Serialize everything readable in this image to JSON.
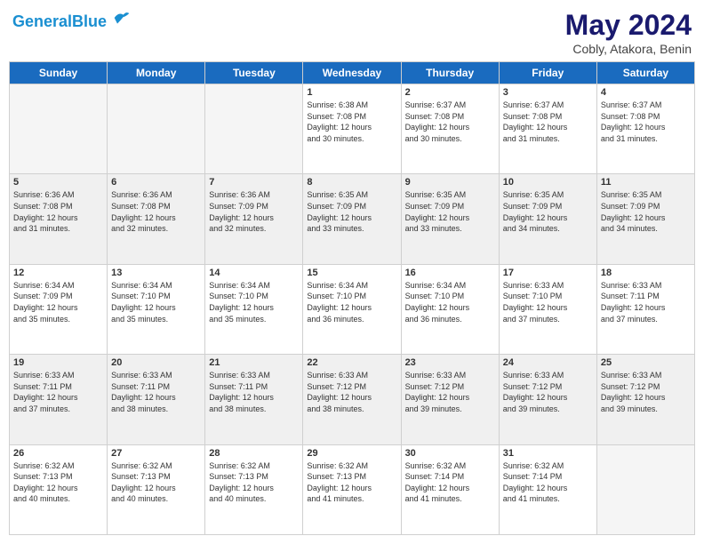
{
  "header": {
    "logo_line1": "General",
    "logo_line2": "Blue",
    "title": "May 2024",
    "subtitle": "Cobly, Atakora, Benin"
  },
  "weekdays": [
    "Sunday",
    "Monday",
    "Tuesday",
    "Wednesday",
    "Thursday",
    "Friday",
    "Saturday"
  ],
  "weeks": [
    {
      "shaded": false,
      "days": [
        {
          "num": "",
          "info": ""
        },
        {
          "num": "",
          "info": ""
        },
        {
          "num": "",
          "info": ""
        },
        {
          "num": "1",
          "info": "Sunrise: 6:38 AM\nSunset: 7:08 PM\nDaylight: 12 hours\nand 30 minutes."
        },
        {
          "num": "2",
          "info": "Sunrise: 6:37 AM\nSunset: 7:08 PM\nDaylight: 12 hours\nand 30 minutes."
        },
        {
          "num": "3",
          "info": "Sunrise: 6:37 AM\nSunset: 7:08 PM\nDaylight: 12 hours\nand 31 minutes."
        },
        {
          "num": "4",
          "info": "Sunrise: 6:37 AM\nSunset: 7:08 PM\nDaylight: 12 hours\nand 31 minutes."
        }
      ]
    },
    {
      "shaded": true,
      "days": [
        {
          "num": "5",
          "info": "Sunrise: 6:36 AM\nSunset: 7:08 PM\nDaylight: 12 hours\nand 31 minutes."
        },
        {
          "num": "6",
          "info": "Sunrise: 6:36 AM\nSunset: 7:08 PM\nDaylight: 12 hours\nand 32 minutes."
        },
        {
          "num": "7",
          "info": "Sunrise: 6:36 AM\nSunset: 7:09 PM\nDaylight: 12 hours\nand 32 minutes."
        },
        {
          "num": "8",
          "info": "Sunrise: 6:35 AM\nSunset: 7:09 PM\nDaylight: 12 hours\nand 33 minutes."
        },
        {
          "num": "9",
          "info": "Sunrise: 6:35 AM\nSunset: 7:09 PM\nDaylight: 12 hours\nand 33 minutes."
        },
        {
          "num": "10",
          "info": "Sunrise: 6:35 AM\nSunset: 7:09 PM\nDaylight: 12 hours\nand 34 minutes."
        },
        {
          "num": "11",
          "info": "Sunrise: 6:35 AM\nSunset: 7:09 PM\nDaylight: 12 hours\nand 34 minutes."
        }
      ]
    },
    {
      "shaded": false,
      "days": [
        {
          "num": "12",
          "info": "Sunrise: 6:34 AM\nSunset: 7:09 PM\nDaylight: 12 hours\nand 35 minutes."
        },
        {
          "num": "13",
          "info": "Sunrise: 6:34 AM\nSunset: 7:10 PM\nDaylight: 12 hours\nand 35 minutes."
        },
        {
          "num": "14",
          "info": "Sunrise: 6:34 AM\nSunset: 7:10 PM\nDaylight: 12 hours\nand 35 minutes."
        },
        {
          "num": "15",
          "info": "Sunrise: 6:34 AM\nSunset: 7:10 PM\nDaylight: 12 hours\nand 36 minutes."
        },
        {
          "num": "16",
          "info": "Sunrise: 6:34 AM\nSunset: 7:10 PM\nDaylight: 12 hours\nand 36 minutes."
        },
        {
          "num": "17",
          "info": "Sunrise: 6:33 AM\nSunset: 7:10 PM\nDaylight: 12 hours\nand 37 minutes."
        },
        {
          "num": "18",
          "info": "Sunrise: 6:33 AM\nSunset: 7:11 PM\nDaylight: 12 hours\nand 37 minutes."
        }
      ]
    },
    {
      "shaded": true,
      "days": [
        {
          "num": "19",
          "info": "Sunrise: 6:33 AM\nSunset: 7:11 PM\nDaylight: 12 hours\nand 37 minutes."
        },
        {
          "num": "20",
          "info": "Sunrise: 6:33 AM\nSunset: 7:11 PM\nDaylight: 12 hours\nand 38 minutes."
        },
        {
          "num": "21",
          "info": "Sunrise: 6:33 AM\nSunset: 7:11 PM\nDaylight: 12 hours\nand 38 minutes."
        },
        {
          "num": "22",
          "info": "Sunrise: 6:33 AM\nSunset: 7:12 PM\nDaylight: 12 hours\nand 38 minutes."
        },
        {
          "num": "23",
          "info": "Sunrise: 6:33 AM\nSunset: 7:12 PM\nDaylight: 12 hours\nand 39 minutes."
        },
        {
          "num": "24",
          "info": "Sunrise: 6:33 AM\nSunset: 7:12 PM\nDaylight: 12 hours\nand 39 minutes."
        },
        {
          "num": "25",
          "info": "Sunrise: 6:33 AM\nSunset: 7:12 PM\nDaylight: 12 hours\nand 39 minutes."
        }
      ]
    },
    {
      "shaded": false,
      "days": [
        {
          "num": "26",
          "info": "Sunrise: 6:32 AM\nSunset: 7:13 PM\nDaylight: 12 hours\nand 40 minutes."
        },
        {
          "num": "27",
          "info": "Sunrise: 6:32 AM\nSunset: 7:13 PM\nDaylight: 12 hours\nand 40 minutes."
        },
        {
          "num": "28",
          "info": "Sunrise: 6:32 AM\nSunset: 7:13 PM\nDaylight: 12 hours\nand 40 minutes."
        },
        {
          "num": "29",
          "info": "Sunrise: 6:32 AM\nSunset: 7:13 PM\nDaylight: 12 hours\nand 41 minutes."
        },
        {
          "num": "30",
          "info": "Sunrise: 6:32 AM\nSunset: 7:14 PM\nDaylight: 12 hours\nand 41 minutes."
        },
        {
          "num": "31",
          "info": "Sunrise: 6:32 AM\nSunset: 7:14 PM\nDaylight: 12 hours\nand 41 minutes."
        },
        {
          "num": "",
          "info": ""
        }
      ]
    }
  ]
}
